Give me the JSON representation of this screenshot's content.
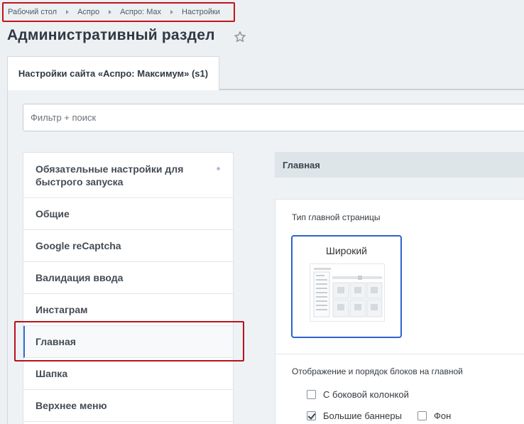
{
  "breadcrumb": {
    "items": [
      "Рабочий стол",
      "Аспро",
      "Аспро: Max",
      "Настройки"
    ]
  },
  "page": {
    "title": "Административный раздел"
  },
  "tab": {
    "label": "Настройки сайта «Аспро: Максимум» (s1)"
  },
  "filter": {
    "placeholder": "Фильтр + поиск"
  },
  "menu": {
    "items": [
      {
        "label": "Обязательные настройки для быстрого запуска",
        "line1": "Обязательные настройки для",
        "line2": "быстрого запуска",
        "badge": "*"
      },
      {
        "label": "Общие"
      },
      {
        "label": "Google reCaptcha"
      },
      {
        "label": "Валидация ввода"
      },
      {
        "label": "Инстаграм"
      },
      {
        "label": "Главная",
        "active": true
      },
      {
        "label": "Шапка"
      },
      {
        "label": "Верхнее меню"
      }
    ]
  },
  "section": {
    "title": "Главная",
    "homepage_type_label": "Тип главной страницы",
    "homepage_type_option": "Широкий",
    "blocks_label": "Отображение и порядок блоков на главной",
    "checkboxes": [
      {
        "label": "С боковой колонкой",
        "checked": false
      },
      {
        "label": "Большие баннеры",
        "checked": true
      },
      {
        "label": "Фон",
        "checked": false
      }
    ]
  },
  "colors": {
    "highlight": "#c0151b",
    "accent": "#2e63c9",
    "active_marker": "#2e6fd3"
  }
}
